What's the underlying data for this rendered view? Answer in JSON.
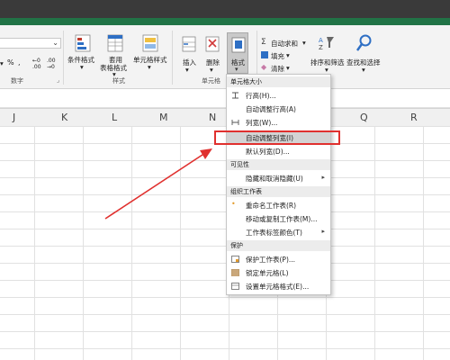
{
  "ribbon": {
    "number_group_label": "数字",
    "styles": {
      "conditional_format": "条件格式",
      "table_format_line1": "套用",
      "table_format_line2": "表格格式",
      "cell_style": "单元格样式",
      "group_label": "样式"
    },
    "cells": {
      "insert": "插入",
      "delete": "删除",
      "format": "格式",
      "group_label": "单元格"
    },
    "editing": {
      "autosum": "自动求和",
      "fill": "填充",
      "clear": "清除",
      "sort_filter": "排序和筛选",
      "find_select": "查找和选择"
    }
  },
  "columns": [
    "J",
    "K",
    "L",
    "M",
    "N",
    "O",
    "P",
    "Q",
    "R"
  ],
  "menu": {
    "sections": [
      {
        "title": "单元格大小",
        "items": [
          {
            "label": "行高(H)...",
            "icon": "row-height-icon"
          },
          {
            "label": "自动调整行高(A)",
            "icon": ""
          },
          {
            "label": "列宽(W)...",
            "icon": "column-width-icon"
          },
          {
            "label": "自动调整列宽(I)",
            "icon": ""
          },
          {
            "label": "默认列宽(D)...",
            "icon": ""
          }
        ]
      },
      {
        "title": "可见性",
        "items": [
          {
            "label": "隐藏和取消隐藏(U)",
            "icon": ""
          }
        ]
      },
      {
        "title": "组织工作表",
        "items": [
          {
            "label": "重命名工作表(R)",
            "icon": "rename-icon"
          },
          {
            "label": "移动或复制工作表(M)...",
            "icon": ""
          },
          {
            "label": "工作表标签颜色(T)",
            "icon": ""
          }
        ]
      },
      {
        "title": "保护",
        "items": [
          {
            "label": "保护工作表(P)...",
            "icon": "protect-sheet-icon"
          },
          {
            "label": "锁定单元格(L)",
            "icon": "lock-cell-icon"
          },
          {
            "label": "设置单元格格式(E)...",
            "icon": "format-cells-icon"
          }
        ]
      }
    ],
    "highlighted": "自动调整列宽(I)"
  },
  "colors": {
    "accent_green": "#217346",
    "annotation_red": "#e0302e"
  }
}
